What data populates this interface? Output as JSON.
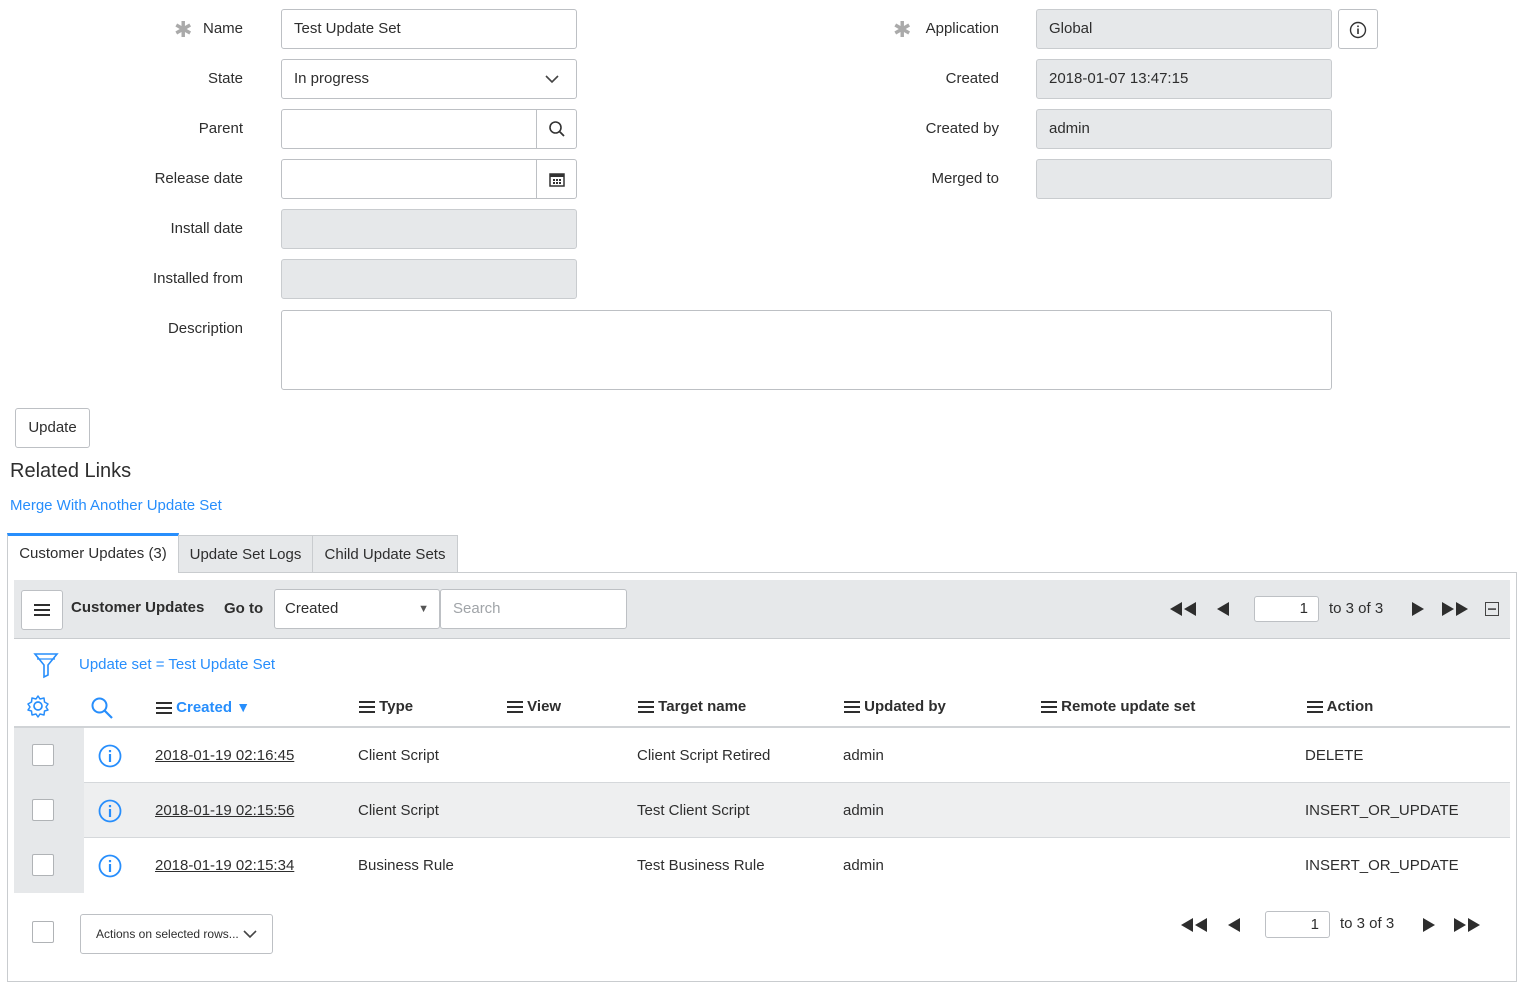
{
  "form": {
    "name_label": "Name",
    "name_value": "Test Update Set",
    "state_label": "State",
    "state_value": "In progress",
    "parent_label": "Parent",
    "parent_value": "",
    "release_date_label": "Release date",
    "release_date_value": "",
    "install_date_label": "Install date",
    "installed_from_label": "Installed from",
    "description_label": "Description",
    "description_value": "",
    "application_label": "Application",
    "application_value": "Global",
    "created_label": "Created",
    "created_value": "2018-01-07 13:47:15",
    "created_by_label": "Created by",
    "created_by_value": "admin",
    "merged_to_label": "Merged to",
    "merged_to_value": ""
  },
  "update_button": "Update",
  "related_links": {
    "heading": "Related Links",
    "merge_link": "Merge With Another Update Set"
  },
  "tabs": [
    {
      "label": "Customer Updates (3)",
      "active": true
    },
    {
      "label": "Update Set Logs",
      "active": false
    },
    {
      "label": "Child Update Sets",
      "active": false
    }
  ],
  "list": {
    "title": "Customer Updates",
    "goto_label": "Go to",
    "goto_field": "Created",
    "search_placeholder": "Search",
    "page_value": "1",
    "page_info": "to 3 of 3",
    "filter_text": "Update set = Test Update Set",
    "columns": [
      "Created",
      "Type",
      "View",
      "Target name",
      "Updated by",
      "Remote update set",
      "Action"
    ],
    "sort_column": "Created",
    "rows": [
      {
        "created": "2018-01-19 02:16:45",
        "type": "Client Script",
        "view": "",
        "target": "Client Script Retired",
        "updated_by": "admin",
        "remote": "",
        "action": "DELETE"
      },
      {
        "created": "2018-01-19 02:15:56",
        "type": "Client Script",
        "view": "",
        "target": "Test Client Script",
        "updated_by": "admin",
        "remote": "",
        "action": "INSERT_OR_UPDATE"
      },
      {
        "created": "2018-01-19 02:15:34",
        "type": "Business Rule",
        "view": "",
        "target": "Test Business Rule",
        "updated_by": "admin",
        "remote": "",
        "action": "INSERT_OR_UPDATE"
      }
    ],
    "actions_label": "Actions on selected rows...",
    "footer_page_value": "1",
    "footer_page_info": "to 3 of 3"
  },
  "colors": {
    "accent": "#278efc",
    "readonly_bg": "#e6e8ea",
    "border": "#bdc0c4"
  },
  "icons": [
    "required-asterisk-icon",
    "chevron-down-icon",
    "search-icon",
    "calendar-icon",
    "info-icon",
    "hamburger-icon",
    "first-page-icon",
    "prev-page-icon",
    "next-page-icon",
    "last-page-icon",
    "collapse-icon",
    "filter-icon",
    "gear-icon",
    "sort-desc-icon"
  ]
}
